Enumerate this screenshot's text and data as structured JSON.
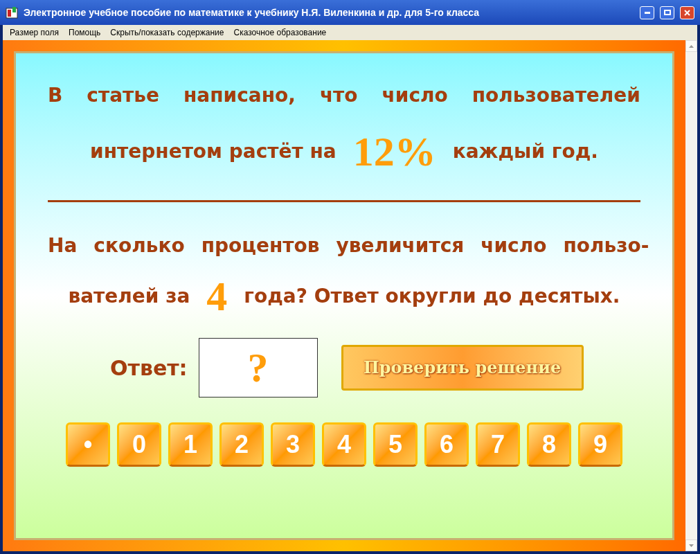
{
  "window": {
    "title": "Электронное учебное пособие по математике к учебнику Н.Я. Виленкина и др. для 5-го класса"
  },
  "menu": [
    "Размер поля",
    "Помощь",
    "Скрыть/показать содержание",
    "Сказочное образование"
  ],
  "statement": [
    [
      {
        "kind": "text",
        "text": "В статье написано, что число пользователей"
      }
    ],
    [
      {
        "kind": "text",
        "text": "интернетом растёт на"
      },
      {
        "kind": "number",
        "text": "12%"
      },
      {
        "kind": "text",
        "text": "каждый год."
      }
    ]
  ],
  "question": [
    [
      {
        "kind": "text",
        "text": "На сколько процентов увеличится число пользо-"
      }
    ],
    [
      {
        "kind": "text",
        "text": "вателей за"
      },
      {
        "kind": "number",
        "text": "4"
      },
      {
        "kind": "text",
        "text": "года? Ответ округли до десятых."
      }
    ]
  ],
  "answer": {
    "label": "Ответ:",
    "value": "?"
  },
  "check_button": "Проверить решение",
  "keys": [
    "•",
    "0",
    "1",
    "2",
    "3",
    "4",
    "5",
    "6",
    "7",
    "8",
    "9"
  ]
}
